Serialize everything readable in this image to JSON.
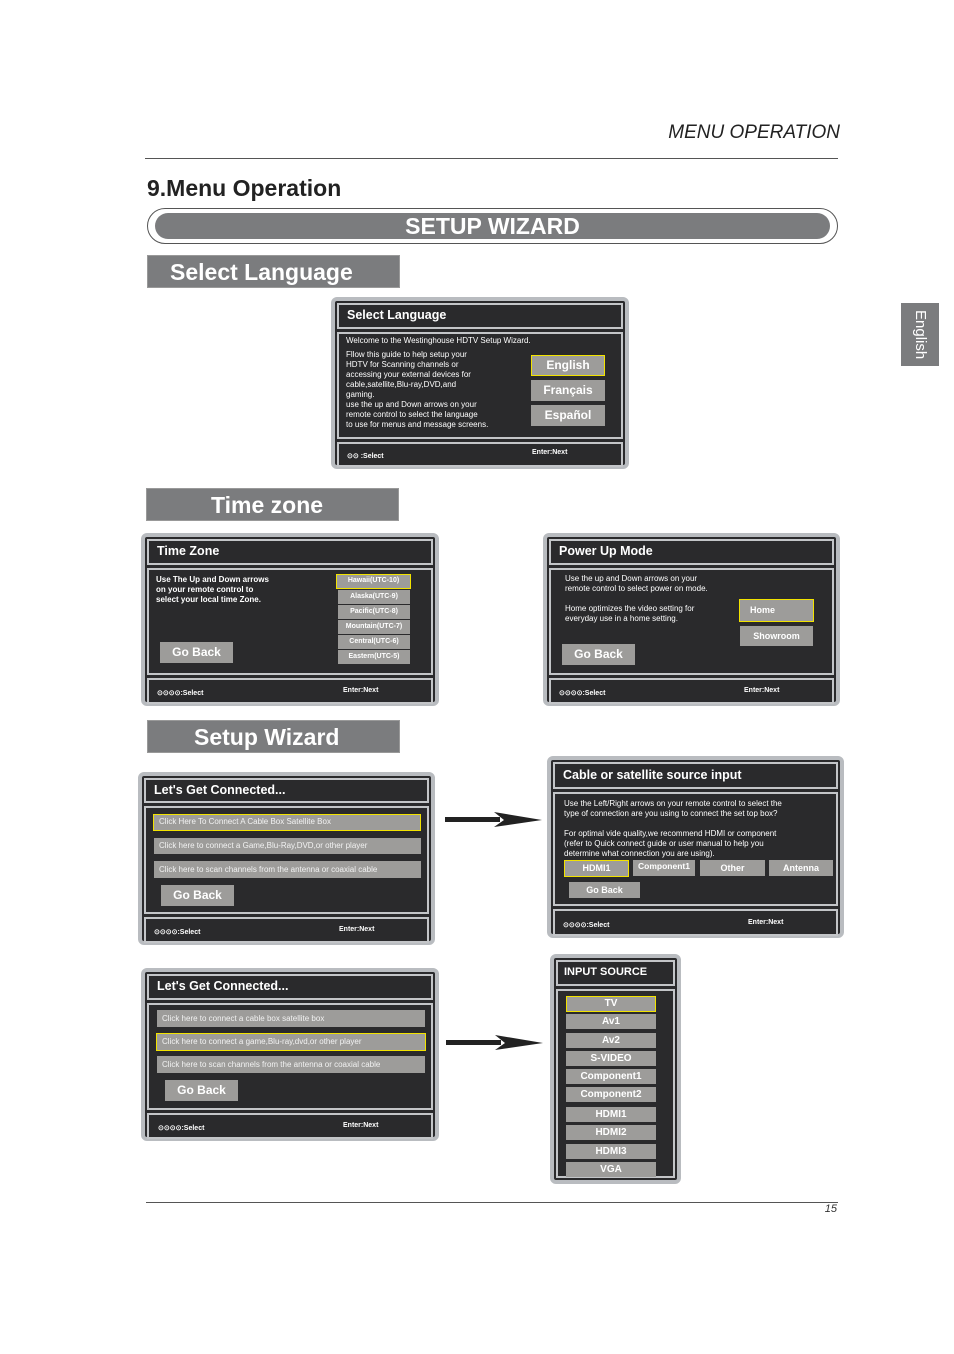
{
  "header": {
    "running_title": "MENU OPERATION",
    "page_title": "9.Menu Operation",
    "banner": "SETUP  WIZARD",
    "side_tab": "English",
    "page_number": "15"
  },
  "sections": {
    "select_language": "Select  Language",
    "time_zone": "Time zone",
    "setup_wizard": "Setup Wizard"
  },
  "colors": {
    "panel_bg": "#2a2a2c",
    "panel_border": "#b9bcc0",
    "button": "#9d9c9a",
    "selected_outline": "#f2e300",
    "section_label": "#7b7c7e"
  },
  "footer_common": {
    "select": ":Select",
    "next": "Enter:Next",
    "icon": "arrow-keys-icon"
  },
  "language_panel": {
    "title": "Select Language",
    "welcome": "Welcome to the Westinghouse HDTV Setup Wizard.",
    "body": "Fllow this guide to help setup your\nHDTV for Scanning channels or\naccessing your external devices for\ncable,satellite,Blu-ray,DVD,and\ngaming.\nuse the up and Down arrows on your\nremote control to select the language\nto use for menus and message screens.",
    "options": [
      "English",
      "Français",
      "Español"
    ],
    "selected": "English"
  },
  "timezone_panel": {
    "title": "Time Zone",
    "body": "Use The Up and Down arrows\non your remote control to\nselect your local time Zone.",
    "options": [
      "Hawaii(UTC-10)",
      "Alaska(UTC-9)",
      "Pacific(UTC-8)",
      "Mountain(UTC-7)",
      "Central(UTC-6)",
      "Eastern(UTC-5)"
    ],
    "selected": "Hawaii(UTC-10)",
    "go_back": "Go Back"
  },
  "powerup_panel": {
    "title": "Power Up Mode",
    "body1": "Use the up and Down arrows on your\nremote control to select power on mode.",
    "body2": "Home optimizes the video setting for\neveryday use in a home setting.",
    "options": [
      "Home",
      "Showroom"
    ],
    "selected": "Home",
    "go_back": "Go Back"
  },
  "connect_panel_1": {
    "title": "Let's Get Connected...",
    "options": [
      "Click Here To Connect A Cable Box Satellite Box",
      "Click here to connect a Game,Blu-Ray,DVD,or other player",
      "Click here to scan channels from the antenna or coaxial cable"
    ],
    "selected_index": 0,
    "go_back": "Go Back"
  },
  "connect_panel_2": {
    "title": "Let's Get Connected...",
    "options": [
      "Click here to connect a cable box satellite box",
      "Click here to connect a game,Blu-ray,dvd,or other player",
      "Click here to scan channels from the antenna or coaxial cable"
    ],
    "selected_index": 1,
    "go_back": "Go Back"
  },
  "cable_panel": {
    "title": "Cable or satellite source input",
    "body1": "Use the Left/Right arrows on your remote control to select the\ntype of connection are you using to connect the set top box?",
    "body2": "For optimal vide quality,we recommend HDMI or component\n(refer to Quick connect guide or user manual to help you\ndetermine what connection you are using).",
    "options": [
      "HDMI1",
      "Component1",
      "Other",
      "Antenna"
    ],
    "selected": "HDMI1",
    "go_back": "Go Back"
  },
  "input_source_panel": {
    "title": "INPUT SOURCE",
    "options": [
      "TV",
      "Av1",
      "Av2",
      "S-VIDEO",
      "Component1",
      "Component2",
      "HDMI1",
      "HDMI2",
      "HDMI3",
      "VGA"
    ],
    "selected": "TV"
  }
}
